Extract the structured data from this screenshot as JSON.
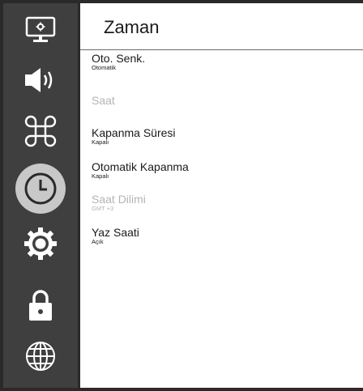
{
  "sidebar": {
    "items": [
      {
        "icon": "display-settings-icon",
        "selected": false
      },
      {
        "icon": "speaker-icon",
        "selected": false
      },
      {
        "icon": "command-icon",
        "selected": false
      },
      {
        "icon": "clock-icon",
        "selected": true
      },
      {
        "icon": "gear-icon",
        "selected": false
      },
      {
        "icon": "lock-icon",
        "selected": false
      },
      {
        "icon": "globe-icon",
        "selected": false
      }
    ],
    "selected_color": "#c8c8c8",
    "icon_color": "#ffffff"
  },
  "header": {
    "title": "Zaman"
  },
  "settings": [
    {
      "label": "Oto. Senk.",
      "value": "Otomatik",
      "enabled": true
    },
    {
      "label": "Saat",
      "value": "",
      "enabled": false
    },
    {
      "label": "Kapanma Süresi",
      "value": "Kapalı",
      "enabled": true
    },
    {
      "label": "Otomatik Kapanma",
      "value": "Kapalı",
      "enabled": true
    },
    {
      "label": "Saat Dilimi",
      "value": "GMT +3",
      "enabled": false
    },
    {
      "label": "Yaz Saati",
      "value": "Açık",
      "enabled": true
    }
  ]
}
